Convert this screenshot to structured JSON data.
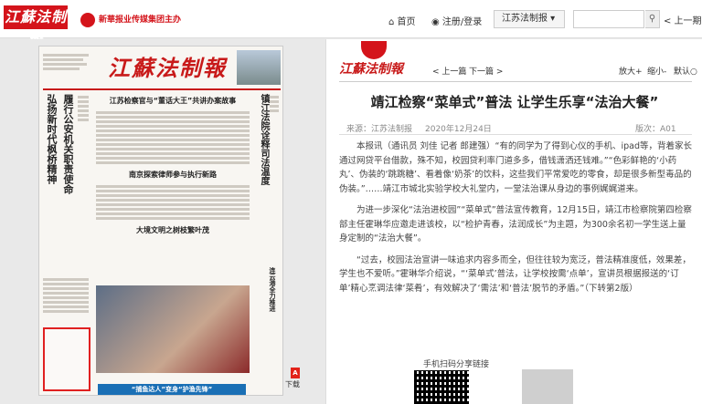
{
  "header": {
    "logo_text": "江蘇法制報",
    "group_name": "新華报业传媒集团主办",
    "home_label": "⌂ 首页",
    "login_label": "◉ 注册/登录",
    "paper_select": "江苏法制报 ▾",
    "search_placeholder": "",
    "search_icon": "search-icon",
    "prev_page_label": "< 上一期"
  },
  "newspaper": {
    "masthead": "江蘇法制報",
    "left_headline": "弘扬新时代枫桥精神",
    "left_headline_2": "履行公安机关职责使命",
    "main_headline_1": "江苏检察官与“董话大王”共讲办案故事",
    "main_headline_2": "南京探索律师参与执行新路",
    "main_headline_3": "大境文明之树枝繁叶茂",
    "right_headline": "镇江法院诠释司法温度",
    "right_headline_2": "连云港全力推进",
    "banner": "“捕鱼达人”变身“护渔先锋”",
    "download_label": "下载",
    "pdf_icon": "pdf-icon"
  },
  "article": {
    "panel_logo": "江蘇法制報",
    "nav_prev": "< 上一篇",
    "nav_next": "下一篇 >",
    "zoom_in": "放大+",
    "zoom_out": "缩小-",
    "zoom_reset": "默认○",
    "title": "靖江检察“菜单式”普法 让学生乐享“法治大餐”",
    "source": "来源：江苏法制报",
    "date": "2020年12月24日",
    "page": "版次：A01",
    "paragraphs": [
      "本报讯（通讯员 刘佳 记者 郎建强）“有的同学为了得到心仪的手机、ipad等，背着家长通过网贷平台借款，殊不知，校园贷利率门道多多，借钱潇洒还钱难。”“色彩鲜艳的‘小药丸’、伪装的‘跳跳糖’、看着像‘奶茶’的饮料，这些我们平常爱吃的零食，却是很多新型毒品的伪装。”……靖江市城北实验学校大礼堂内，一堂法治课从身边的事例娓娓道来。",
      "为进一步深化“法治进校园”“菜单式”普法宣传教育，12月15日，靖江市检察院第四检察部主任霍琳华应邀走进该校，以“检护青春，法润成长”为主题，为300余名初一学生送上量身定制的“法治大餐”。",
      "“过去，校园法治宣讲一味追求内容多而全，但往往较为宽泛，普法精准度低，效果差，学生也不爱听。”霍琳华介绍说，“‘菜单式’普法，让学校按需‘点单’，宣讲员根据报送的‘订单’精心烹调法律‘菜肴’，有效解决了‘需法’和‘普法’脱节的矛盾。”（下转第2版）"
    ],
    "share_label": "手机扫码分享链接"
  }
}
